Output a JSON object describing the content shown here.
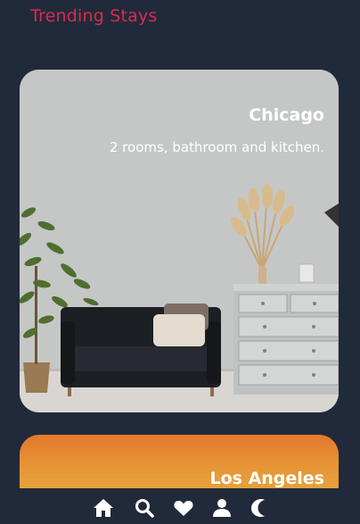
{
  "header": {
    "title": "Trending Stays"
  },
  "cards": [
    {
      "city": "Chicago",
      "description": "2 rooms, bathroom and kitchen."
    },
    {
      "city": "Los Angeles",
      "description": ""
    }
  ],
  "bottom_nav": {
    "items": [
      {
        "icon": "home-icon"
      },
      {
        "icon": "search-icon"
      },
      {
        "icon": "heart-icon"
      },
      {
        "icon": "user-icon"
      },
      {
        "icon": "moon-icon"
      }
    ]
  },
  "colors": {
    "background": "#212a3a",
    "accent": "#d92b4f",
    "text": "#ffffff"
  }
}
